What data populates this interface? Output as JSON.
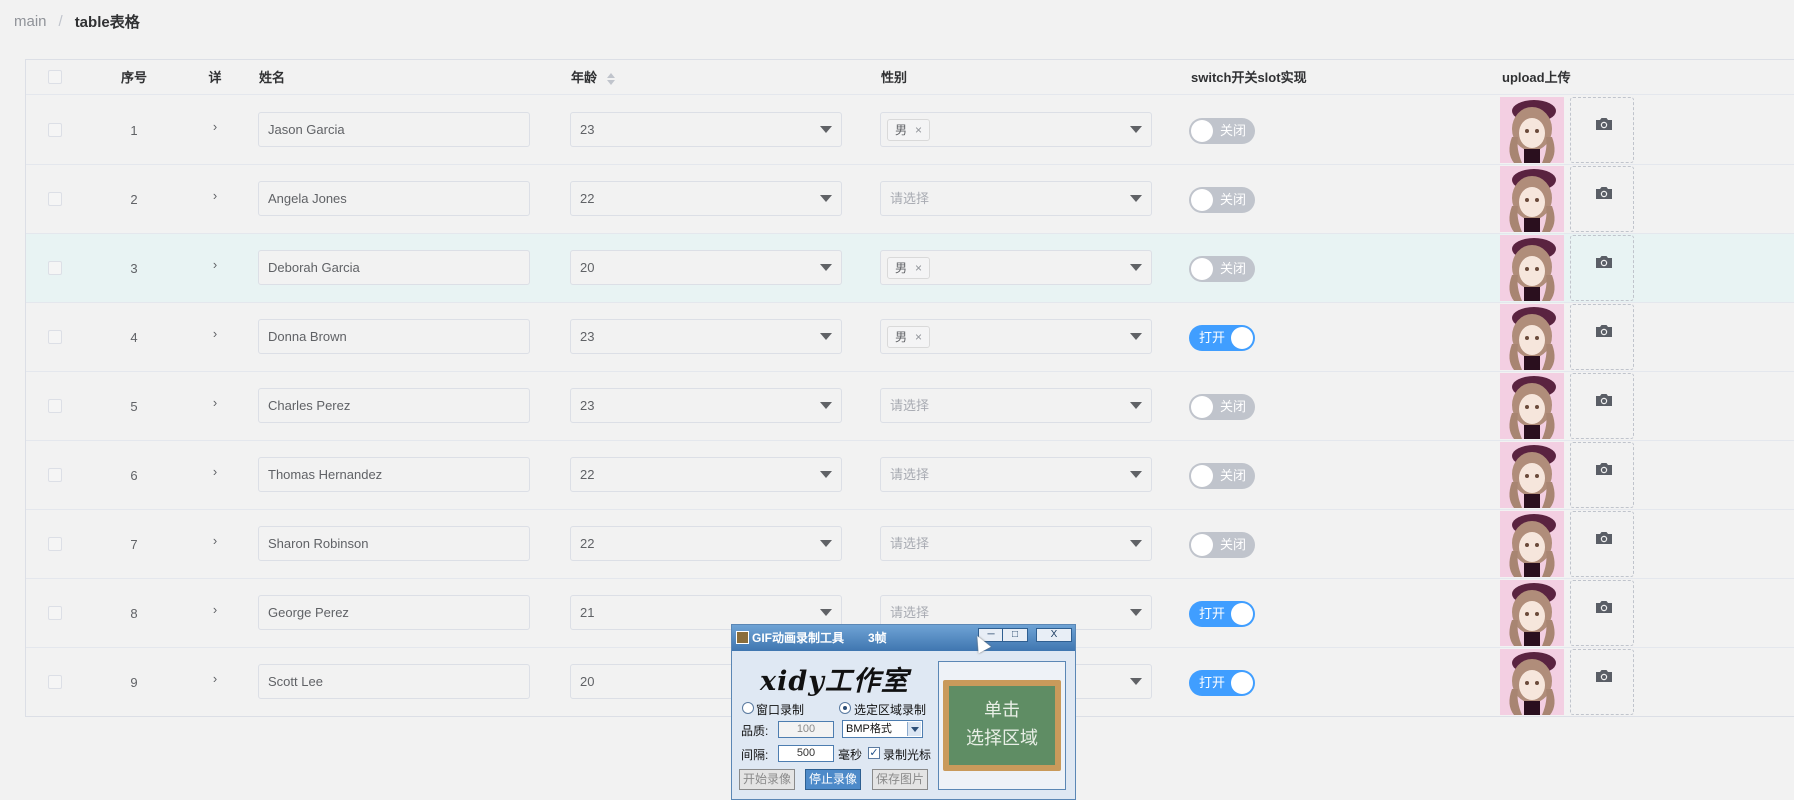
{
  "breadcrumb": {
    "root": "main",
    "separator": "/",
    "current": "table表格"
  },
  "table": {
    "headers": {
      "index": "序号",
      "expand": "详",
      "name": "姓名",
      "age": "年龄",
      "sex": "性别",
      "switch": "switch开关slot实现",
      "upload": "upload上传"
    },
    "sex_placeholder": "请选择",
    "switch_on_label": "打开",
    "switch_off_label": "关闭",
    "tag_remove": "×",
    "expand_glyph": "›",
    "rows": [
      {
        "index": "1",
        "name": "Jason Garcia",
        "age": "23",
        "sex": "男",
        "switch_on": false
      },
      {
        "index": "2",
        "name": "Angela Jones",
        "age": "22",
        "sex": "",
        "switch_on": false
      },
      {
        "index": "3",
        "name": "Deborah Garcia",
        "age": "20",
        "sex": "男",
        "switch_on": false
      },
      {
        "index": "4",
        "name": "Donna Brown",
        "age": "23",
        "sex": "男",
        "switch_on": true
      },
      {
        "index": "5",
        "name": "Charles Perez",
        "age": "23",
        "sex": "",
        "switch_on": false
      },
      {
        "index": "6",
        "name": "Thomas Hernandez",
        "age": "22",
        "sex": "",
        "switch_on": false
      },
      {
        "index": "7",
        "name": "Sharon Robinson",
        "age": "22",
        "sex": "",
        "switch_on": false
      },
      {
        "index": "8",
        "name": "George Perez",
        "age": "21",
        "sex": "",
        "switch_on": true
      },
      {
        "index": "9",
        "name": "Scott Lee",
        "age": "20",
        "sex": "",
        "switch_on": true
      }
    ]
  },
  "gif_tool": {
    "title": "GIF动画录制工具",
    "frames": "3帧",
    "min": "─",
    "max": "□",
    "close": "X",
    "logo": "xidy工作室",
    "radio_window": "窗口录制",
    "radio_region": "选定区域录制",
    "quality_label": "品质:",
    "quality_value": "100",
    "format_value": "BMP格式",
    "interval_label": "间隔:",
    "interval_value": "500",
    "interval_unit": "毫秒",
    "record_cursor": "录制光标",
    "record_cursor_check": "✓",
    "btn_start": "开始录像",
    "btn_stop": "停止录像",
    "btn_save": "保存图片",
    "board_line1": "单击",
    "board_line2": "选择区域"
  },
  "colors": {
    "primary": "#409eff",
    "switch_off": "#c0c4cc",
    "highlight_row": "#e8f3f3"
  }
}
